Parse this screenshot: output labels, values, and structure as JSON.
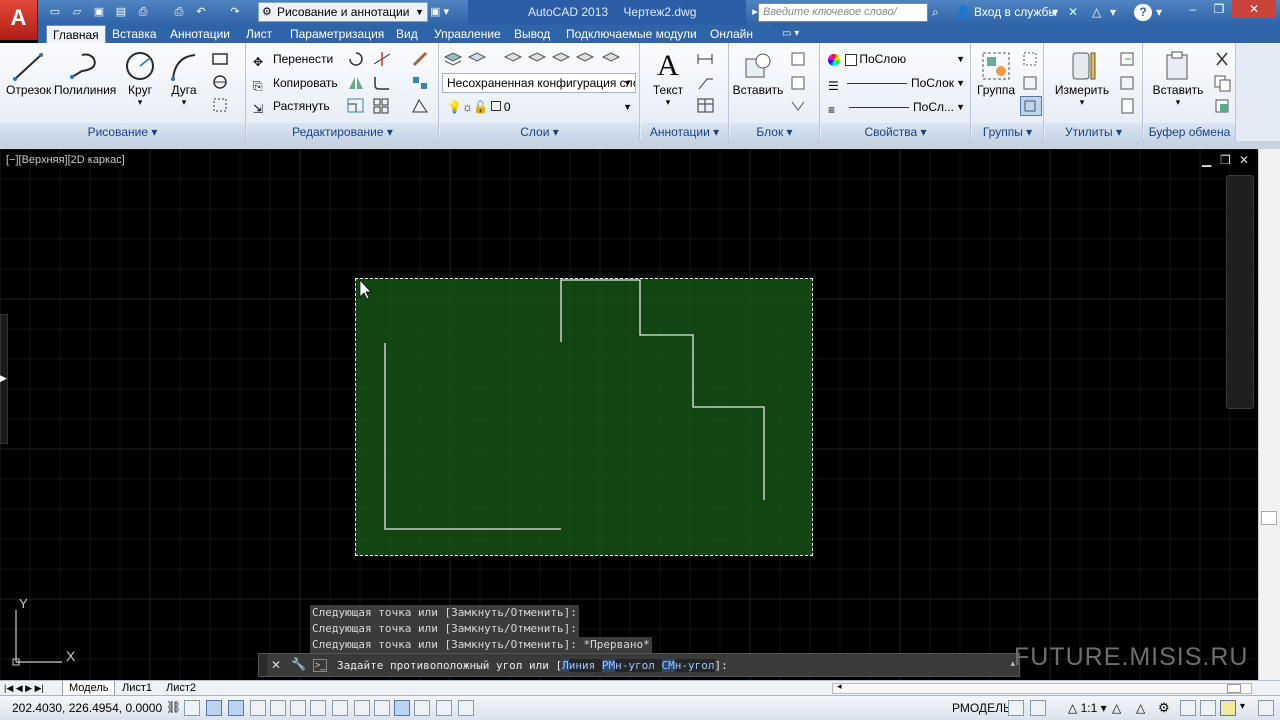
{
  "titlebar": {
    "logo": "A",
    "workspace": "Рисование и аннотации",
    "app_name": "AutoCAD 2013",
    "document": "Чертеж2.dwg",
    "search_placeholder": "Введите ключевое слово/фразу",
    "signin": "Вход в службы",
    "help": "?"
  },
  "tabs": [
    "Главная",
    "Вставка",
    "Аннотации",
    "Лист",
    "Параметризация",
    "Вид",
    "Управление",
    "Вывод",
    "Подключаемые модули",
    "Онлайн"
  ],
  "ribbon": {
    "draw": {
      "title": "Рисование",
      "line": "Отрезок",
      "polyline": "Полилиния",
      "circle": "Круг",
      "arc": "Дуга"
    },
    "modify": {
      "title": "Редактирование",
      "move": "Перенести",
      "copy": "Копировать",
      "stretch": "Растянуть"
    },
    "layers": {
      "title": "Слои",
      "state": "Несохраненная конфигурация сло",
      "current": "0"
    },
    "annotation": {
      "title": "Аннотации",
      "text": "Текст"
    },
    "block": {
      "title": "Блок",
      "insert": "Вставить"
    },
    "properties": {
      "title": "Свойства",
      "color": "ПоСлою",
      "linetype": "ПоСлок",
      "lineweight": "ПоСл..."
    },
    "groups": {
      "title": "Группы",
      "group": "Группа"
    },
    "utilities": {
      "title": "Утилиты",
      "measure": "Измерить"
    },
    "clipboard": {
      "title": "Буфер обмена",
      "paste": "Вставить"
    }
  },
  "viewport": {
    "label": "[−][Верхняя][2D каркас]"
  },
  "ucs": {
    "y": "Y",
    "x": "X"
  },
  "command": {
    "history": [
      "Следующая точка или [Замкнуть/Отменить]:",
      "Следующая точка или [Замкнуть/Отменить]:",
      "Следующая точка или [Замкнуть/Отменить]: *Прервано*"
    ],
    "prompt_start": "Задайте противоположный угол или [",
    "kw1_key": "Л",
    "kw1_rest": "иния ",
    "kw2_key": "РМ",
    "kw2_rest": "н-угол ",
    "kw3_key": "СМ",
    "kw3_rest": "н-угол",
    "prompt_end": "]:"
  },
  "watermark": "FUTURE.MISIS.RU",
  "layouts": [
    "Модель",
    "Лист1",
    "Лист2"
  ],
  "status": {
    "coords": "202.4030, 226.4954, 0.0000",
    "model": "РМОДЕЛЬ",
    "scale": "1:1"
  },
  "colors": {
    "accent": "#2e64a8",
    "selection": "#165816",
    "canvas": "#000000"
  }
}
